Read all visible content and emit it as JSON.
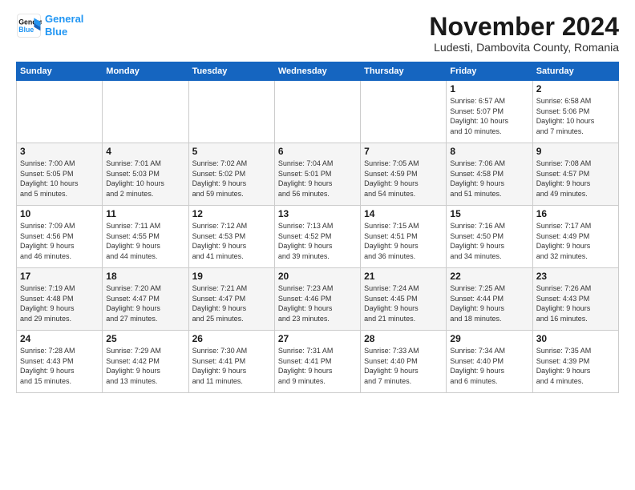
{
  "logo": {
    "line1": "General",
    "line2": "Blue"
  },
  "title": "November 2024",
  "subtitle": "Ludesti, Dambovita County, Romania",
  "weekdays": [
    "Sunday",
    "Monday",
    "Tuesday",
    "Wednesday",
    "Thursday",
    "Friday",
    "Saturday"
  ],
  "weeks": [
    [
      {
        "day": "",
        "info": ""
      },
      {
        "day": "",
        "info": ""
      },
      {
        "day": "",
        "info": ""
      },
      {
        "day": "",
        "info": ""
      },
      {
        "day": "",
        "info": ""
      },
      {
        "day": "1",
        "info": "Sunrise: 6:57 AM\nSunset: 5:07 PM\nDaylight: 10 hours\nand 10 minutes."
      },
      {
        "day": "2",
        "info": "Sunrise: 6:58 AM\nSunset: 5:06 PM\nDaylight: 10 hours\nand 7 minutes."
      }
    ],
    [
      {
        "day": "3",
        "info": "Sunrise: 7:00 AM\nSunset: 5:05 PM\nDaylight: 10 hours\nand 5 minutes."
      },
      {
        "day": "4",
        "info": "Sunrise: 7:01 AM\nSunset: 5:03 PM\nDaylight: 10 hours\nand 2 minutes."
      },
      {
        "day": "5",
        "info": "Sunrise: 7:02 AM\nSunset: 5:02 PM\nDaylight: 9 hours\nand 59 minutes."
      },
      {
        "day": "6",
        "info": "Sunrise: 7:04 AM\nSunset: 5:01 PM\nDaylight: 9 hours\nand 56 minutes."
      },
      {
        "day": "7",
        "info": "Sunrise: 7:05 AM\nSunset: 4:59 PM\nDaylight: 9 hours\nand 54 minutes."
      },
      {
        "day": "8",
        "info": "Sunrise: 7:06 AM\nSunset: 4:58 PM\nDaylight: 9 hours\nand 51 minutes."
      },
      {
        "day": "9",
        "info": "Sunrise: 7:08 AM\nSunset: 4:57 PM\nDaylight: 9 hours\nand 49 minutes."
      }
    ],
    [
      {
        "day": "10",
        "info": "Sunrise: 7:09 AM\nSunset: 4:56 PM\nDaylight: 9 hours\nand 46 minutes."
      },
      {
        "day": "11",
        "info": "Sunrise: 7:11 AM\nSunset: 4:55 PM\nDaylight: 9 hours\nand 44 minutes."
      },
      {
        "day": "12",
        "info": "Sunrise: 7:12 AM\nSunset: 4:53 PM\nDaylight: 9 hours\nand 41 minutes."
      },
      {
        "day": "13",
        "info": "Sunrise: 7:13 AM\nSunset: 4:52 PM\nDaylight: 9 hours\nand 39 minutes."
      },
      {
        "day": "14",
        "info": "Sunrise: 7:15 AM\nSunset: 4:51 PM\nDaylight: 9 hours\nand 36 minutes."
      },
      {
        "day": "15",
        "info": "Sunrise: 7:16 AM\nSunset: 4:50 PM\nDaylight: 9 hours\nand 34 minutes."
      },
      {
        "day": "16",
        "info": "Sunrise: 7:17 AM\nSunset: 4:49 PM\nDaylight: 9 hours\nand 32 minutes."
      }
    ],
    [
      {
        "day": "17",
        "info": "Sunrise: 7:19 AM\nSunset: 4:48 PM\nDaylight: 9 hours\nand 29 minutes."
      },
      {
        "day": "18",
        "info": "Sunrise: 7:20 AM\nSunset: 4:47 PM\nDaylight: 9 hours\nand 27 minutes."
      },
      {
        "day": "19",
        "info": "Sunrise: 7:21 AM\nSunset: 4:47 PM\nDaylight: 9 hours\nand 25 minutes."
      },
      {
        "day": "20",
        "info": "Sunrise: 7:23 AM\nSunset: 4:46 PM\nDaylight: 9 hours\nand 23 minutes."
      },
      {
        "day": "21",
        "info": "Sunrise: 7:24 AM\nSunset: 4:45 PM\nDaylight: 9 hours\nand 21 minutes."
      },
      {
        "day": "22",
        "info": "Sunrise: 7:25 AM\nSunset: 4:44 PM\nDaylight: 9 hours\nand 18 minutes."
      },
      {
        "day": "23",
        "info": "Sunrise: 7:26 AM\nSunset: 4:43 PM\nDaylight: 9 hours\nand 16 minutes."
      }
    ],
    [
      {
        "day": "24",
        "info": "Sunrise: 7:28 AM\nSunset: 4:43 PM\nDaylight: 9 hours\nand 15 minutes."
      },
      {
        "day": "25",
        "info": "Sunrise: 7:29 AM\nSunset: 4:42 PM\nDaylight: 9 hours\nand 13 minutes."
      },
      {
        "day": "26",
        "info": "Sunrise: 7:30 AM\nSunset: 4:41 PM\nDaylight: 9 hours\nand 11 minutes."
      },
      {
        "day": "27",
        "info": "Sunrise: 7:31 AM\nSunset: 4:41 PM\nDaylight: 9 hours\nand 9 minutes."
      },
      {
        "day": "28",
        "info": "Sunrise: 7:33 AM\nSunset: 4:40 PM\nDaylight: 9 hours\nand 7 minutes."
      },
      {
        "day": "29",
        "info": "Sunrise: 7:34 AM\nSunset: 4:40 PM\nDaylight: 9 hours\nand 6 minutes."
      },
      {
        "day": "30",
        "info": "Sunrise: 7:35 AM\nSunset: 4:39 PM\nDaylight: 9 hours\nand 4 minutes."
      }
    ]
  ]
}
